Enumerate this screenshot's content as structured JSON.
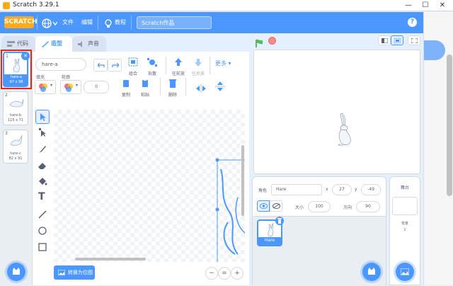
{
  "window": {
    "title": "Scratch 3.29.1",
    "minimize": "—",
    "maximize": "☐",
    "close": "✕"
  },
  "menu": {
    "logo": "SCRATCH",
    "file": "文件",
    "edit": "编辑",
    "tutorials": "教程",
    "project_name": "Scratch作品",
    "help": "?"
  },
  "tabs": {
    "code": "代码",
    "costumes": "造型",
    "sounds": "声音"
  },
  "costumes": [
    {
      "num": "1",
      "name": "hare-a",
      "size": "67 x 98"
    },
    {
      "num": "2",
      "name": "hare-b",
      "size": "115 x 71"
    },
    {
      "num": "3",
      "name": "hare-c",
      "size": "82 x 91"
    }
  ],
  "editor": {
    "costume_name": "hare-a",
    "group": "组合",
    "ungroup": "拆散",
    "forward": "往前放",
    "backward": "往后放",
    "more": "更多",
    "fill": "填充",
    "outline": "轮廓",
    "outline_width": "0",
    "copy": "复制",
    "paste": "粘贴",
    "delete": "删除",
    "convert": "转换为位图",
    "zoom_out": "−",
    "zoom_reset": "=",
    "zoom_in": "+"
  },
  "sprite": {
    "label_sprite": "角色",
    "name": "Hare",
    "x_label": "x",
    "x": "27",
    "y_label": "y",
    "y": "-49",
    "size_label": "大小",
    "size": "100",
    "dir_label": "方向",
    "dir": "90",
    "thumb_name": "Hare"
  },
  "stage_panel": {
    "title": "舞台",
    "backdrops_label": "背景",
    "backdrops_count": "1"
  },
  "colors": {
    "accent": "#4c97ff",
    "highlight": "#e0271a",
    "stage_bg": "#ffffff"
  }
}
